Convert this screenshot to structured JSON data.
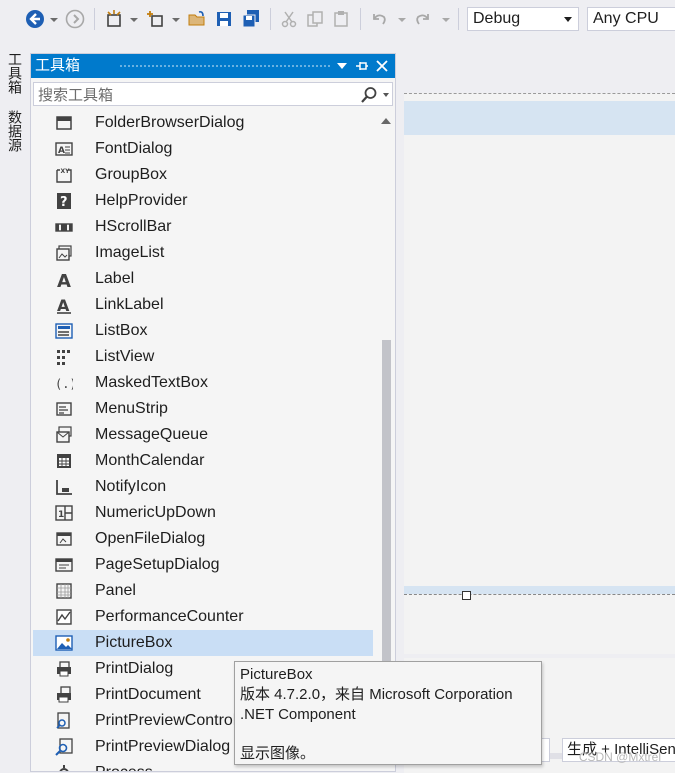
{
  "toolbar": {
    "config_value": "Debug",
    "platform_value": "Any CPU"
  },
  "side_tabs": [
    "工具箱",
    "数据源"
  ],
  "toolbox": {
    "title": "工具箱",
    "search_placeholder": "搜索工具箱",
    "items": [
      {
        "label": "FolderBrowserDialog",
        "icon": "folder-browser-icon"
      },
      {
        "label": "FontDialog",
        "icon": "font-dialog-icon"
      },
      {
        "label": "GroupBox",
        "icon": "group-box-icon"
      },
      {
        "label": "HelpProvider",
        "icon": "help-provider-icon"
      },
      {
        "label": "HScrollBar",
        "icon": "hscrollbar-icon"
      },
      {
        "label": "ImageList",
        "icon": "image-list-icon"
      },
      {
        "label": "Label",
        "icon": "label-icon"
      },
      {
        "label": "LinkLabel",
        "icon": "link-label-icon"
      },
      {
        "label": "ListBox",
        "icon": "list-box-icon"
      },
      {
        "label": "ListView",
        "icon": "list-view-icon"
      },
      {
        "label": "MaskedTextBox",
        "icon": "masked-textbox-icon"
      },
      {
        "label": "MenuStrip",
        "icon": "menu-strip-icon"
      },
      {
        "label": "MessageQueue",
        "icon": "message-queue-icon"
      },
      {
        "label": "MonthCalendar",
        "icon": "month-calendar-icon"
      },
      {
        "label": "NotifyIcon",
        "icon": "notify-icon-icon"
      },
      {
        "label": "NumericUpDown",
        "icon": "numeric-updown-icon"
      },
      {
        "label": "OpenFileDialog",
        "icon": "open-file-dialog-icon"
      },
      {
        "label": "PageSetupDialog",
        "icon": "page-setup-dialog-icon"
      },
      {
        "label": "Panel",
        "icon": "panel-icon"
      },
      {
        "label": "PerformanceCounter",
        "icon": "performance-counter-icon"
      },
      {
        "label": "PictureBox",
        "icon": "picture-box-icon"
      },
      {
        "label": "PrintDialog",
        "icon": "print-dialog-icon"
      },
      {
        "label": "PrintDocument",
        "icon": "print-document-icon"
      },
      {
        "label": "PrintPreviewControl",
        "icon": "print-preview-control-icon"
      },
      {
        "label": "PrintPreviewDialog",
        "icon": "print-preview-dialog-icon"
      },
      {
        "label": "Process",
        "icon": "process-icon"
      }
    ],
    "selected_index": 20
  },
  "tooltip": {
    "name": "PictureBox",
    "version": "版本 4.7.2.0，来自 Microsoft Corporation",
    "kind": ".NET Component",
    "description": "显示图像。"
  },
  "bottom_bar": {
    "build_filter": "生成 + IntelliSense"
  },
  "watermark": "CSDN @Mxtrel",
  "colors": {
    "accent": "#007acc",
    "selection": "#c9def5",
    "panel_bg": "#f5f5f5",
    "chrome_bg": "#eeeef2"
  }
}
